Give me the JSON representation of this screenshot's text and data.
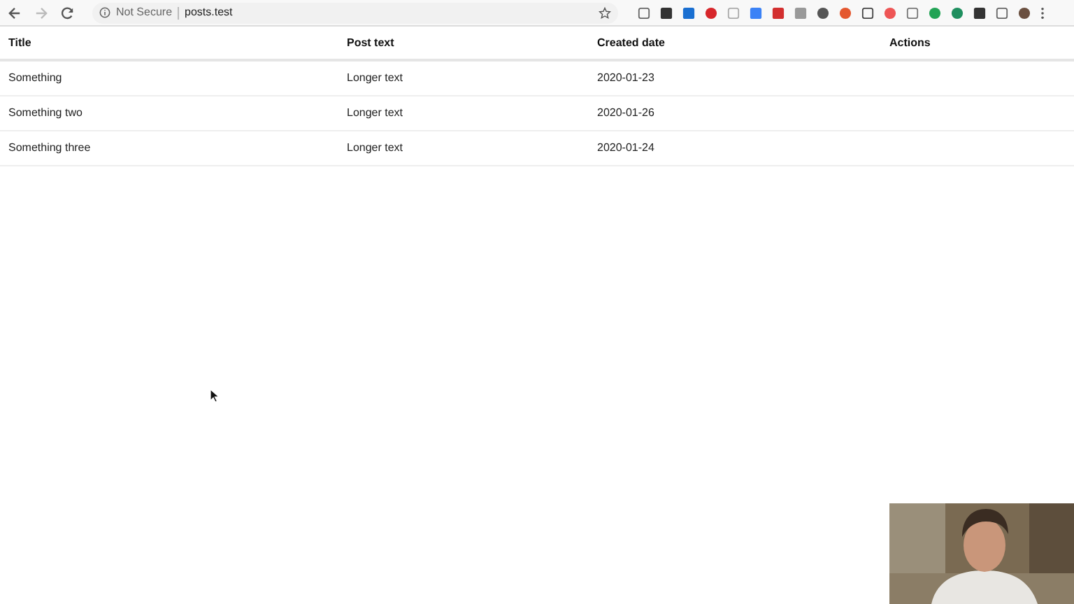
{
  "browser": {
    "security_label": "Not Secure",
    "url": "posts.test"
  },
  "table": {
    "columns": [
      "Title",
      "Post text",
      "Created date",
      "Actions"
    ],
    "rows": [
      [
        "Something",
        "Longer text",
        "2020-01-23",
        ""
      ],
      [
        "Something two",
        "Longer text",
        "2020-01-26",
        ""
      ],
      [
        "Something three",
        "Longer text",
        "2020-01-24",
        ""
      ]
    ]
  }
}
